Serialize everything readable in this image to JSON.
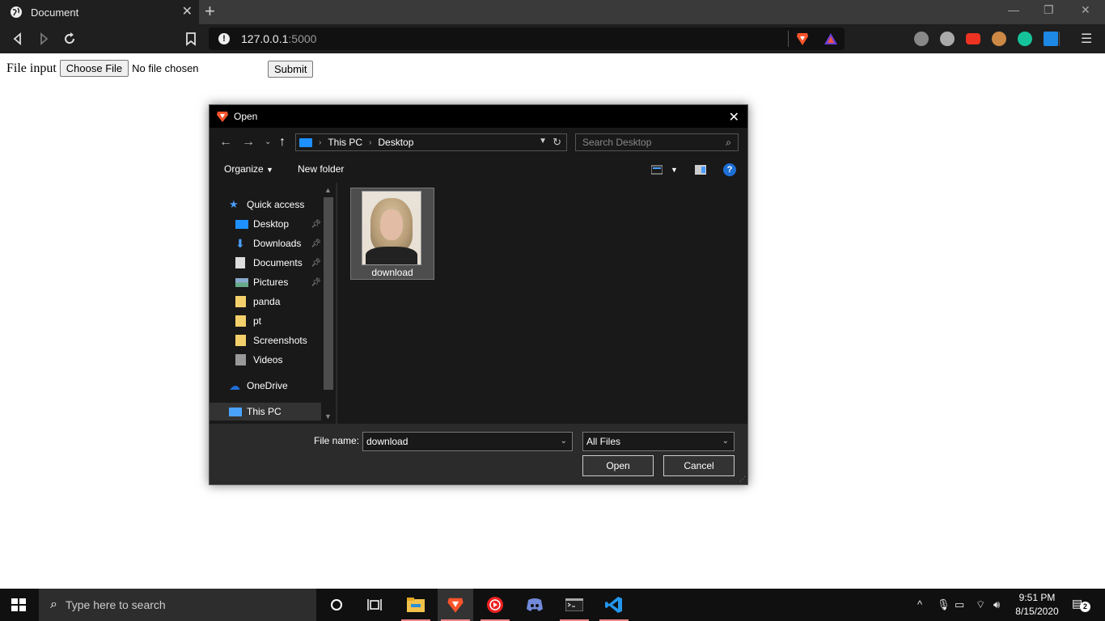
{
  "browser": {
    "tab_title": "Document",
    "url_host": "127.0.0.1",
    "url_port": ":5000"
  },
  "page": {
    "file_label": "File input",
    "choose_button": "Choose File",
    "no_file_text": "No file chosen",
    "submit_button": "Submit"
  },
  "dialog": {
    "title": "Open",
    "breadcrumb": [
      "This PC",
      "Desktop"
    ],
    "search_placeholder": "Search Desktop",
    "organize": "Organize",
    "new_folder": "New folder",
    "nav_items": [
      {
        "label": "Quick access",
        "icon": "star-icon",
        "pinned": false
      },
      {
        "label": "Desktop",
        "icon": "desktop-icon",
        "pinned": true
      },
      {
        "label": "Downloads",
        "icon": "download-arrow-icon",
        "pinned": true
      },
      {
        "label": "Documents",
        "icon": "document-icon",
        "pinned": true
      },
      {
        "label": "Pictures",
        "icon": "pictures-icon",
        "pinned": true
      },
      {
        "label": "panda",
        "icon": "folder-icon",
        "pinned": false
      },
      {
        "label": "pt",
        "icon": "folder-icon",
        "pinned": false
      },
      {
        "label": "Screenshots",
        "icon": "folder-icon",
        "pinned": false
      },
      {
        "label": "Videos",
        "icon": "videos-icon",
        "pinned": false
      },
      {
        "label": "OneDrive",
        "icon": "cloud-icon",
        "pinned": false
      },
      {
        "label": "This PC",
        "icon": "computer-icon",
        "pinned": false
      }
    ],
    "file": {
      "name": "download"
    },
    "file_name_label": "File name:",
    "file_name_value": "download",
    "filter_value": "All Files",
    "open_button": "Open",
    "cancel_button": "Cancel"
  },
  "taskbar": {
    "search_placeholder": "Type here to search",
    "time": "9:51 PM",
    "date": "8/15/2020",
    "notification_count": "2"
  },
  "colors": {
    "brave_orange": "#fb542b",
    "dialog_bg": "#2b2b2b",
    "windows_blue": "#1e90ff"
  }
}
